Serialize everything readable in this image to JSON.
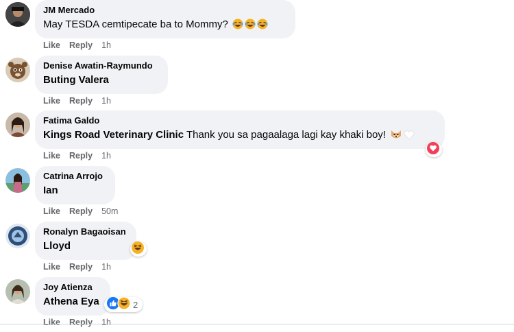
{
  "comments": [
    {
      "author": "JM Mercado",
      "mention": "",
      "text": "May TESDA cemtipecate ba to Mommy?",
      "emojis": [
        "laugh-crying-emoji",
        "laugh-crying-emoji",
        "laugh-crying-emoji"
      ],
      "like": "Like",
      "reply": "Reply",
      "time": "1h"
    },
    {
      "author": "Denise Awatin-Raymundo",
      "mention": "Buting Valera",
      "text": "",
      "like": "Like",
      "reply": "Reply",
      "time": "1h"
    },
    {
      "author": "Fatima Galdo",
      "mention": "Kings Road Veterinary Clinic",
      "text": " Thank you sa pagaalaga lagi kay khaki boy!",
      "emojis": [
        "dog-face-emoji",
        "white-heart-emoji"
      ],
      "reaction": "love-reaction",
      "like": "Like",
      "reply": "Reply",
      "time": "1h"
    },
    {
      "author": "Catrina Arrojo",
      "mention": "Ian",
      "text": "",
      "like": "Like",
      "reply": "Reply",
      "time": "50m"
    },
    {
      "author": "Ronalyn Bagaoisan",
      "mention": "Lloyd",
      "text": "",
      "reaction": "haha-reaction",
      "like": "Like",
      "reply": "Reply",
      "time": "1h"
    },
    {
      "author": "Joy Atienza",
      "mention": "Athena Eya",
      "text": "",
      "reactions": [
        "like-reaction",
        "haha-reaction"
      ],
      "reaction_count": "2",
      "like": "Like",
      "reply": "Reply",
      "time": "1h"
    }
  ],
  "colors": {
    "bubble": "#f0f2f5",
    "meta": "#65676b",
    "like_blue": "#1877f2",
    "love_red": "#f33e58",
    "haha_yellow": "#f7b125"
  }
}
